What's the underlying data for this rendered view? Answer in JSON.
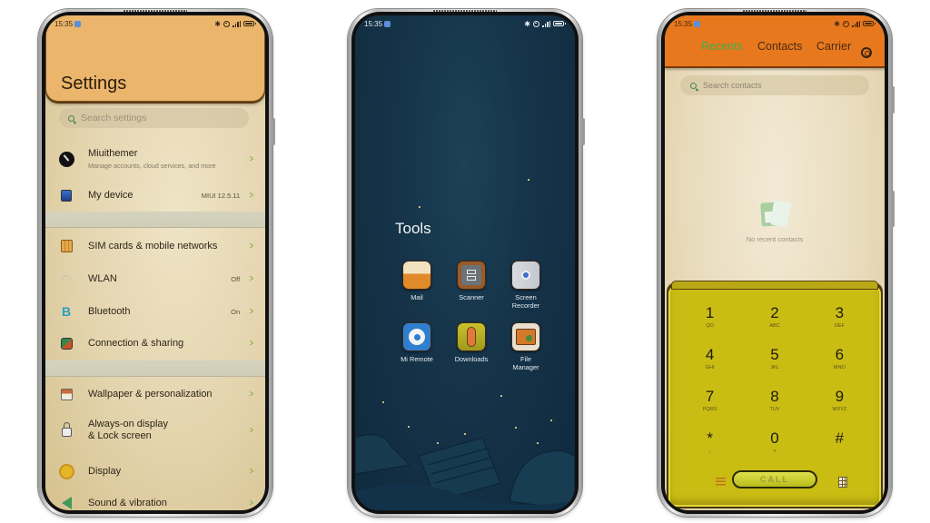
{
  "status_bar": {
    "time": "15:35",
    "icons": [
      "bluetooth-icon",
      "alarm-icon",
      "signal-icon",
      "battery-icon"
    ]
  },
  "settings": {
    "title": "Settings",
    "search_placeholder": "Search settings",
    "items": [
      {
        "icon": "miuithemer-icon",
        "label": "Miuithemer",
        "sub": "Manage accounts, cloud services, and more",
        "value": ""
      },
      {
        "icon": "device-icon",
        "label": "My device",
        "sub": "",
        "value": "MIUI 12.5.11"
      },
      {
        "icon": "sim-card-icon",
        "label": "SIM cards & mobile networks",
        "sub": "",
        "value": ""
      },
      {
        "icon": "wifi-icon",
        "label": "WLAN",
        "sub": "",
        "value": "Off"
      },
      {
        "icon": "bluetooth-icon",
        "label": "Bluetooth",
        "sub": "",
        "value": "On"
      },
      {
        "icon": "connection-icon",
        "label": "Connection & sharing",
        "sub": "",
        "value": ""
      },
      {
        "icon": "wallpaper-icon",
        "label": "Wallpaper & personalization",
        "sub": "",
        "value": ""
      },
      {
        "icon": "lock-icon",
        "label": "Always-on display & Lock screen",
        "sub": "",
        "value": ""
      },
      {
        "icon": "display-icon",
        "label": "Display",
        "sub": "",
        "value": ""
      },
      {
        "icon": "sound-icon",
        "label": "Sound & vibration",
        "sub": "",
        "value": ""
      }
    ]
  },
  "home": {
    "folder_title": "Tools",
    "apps": [
      {
        "name": "Mail",
        "icon": "mail-app-icon"
      },
      {
        "name": "Scanner",
        "icon": "scanner-app-icon"
      },
      {
        "name": "Screen Recorder",
        "icon": "screen-recorder-app-icon"
      },
      {
        "name": "Mi Remote",
        "icon": "mi-remote-app-icon"
      },
      {
        "name": "Downloads",
        "icon": "downloads-app-icon"
      },
      {
        "name": "File Manager",
        "icon": "file-manager-app-icon"
      }
    ]
  },
  "dialer": {
    "tabs": [
      "Recents",
      "Contacts",
      "Carrier"
    ],
    "active_tab": "Recents",
    "search_placeholder": "Search contacts",
    "empty_text": "No recent contacts",
    "keys": [
      {
        "digit": "1",
        "letters": "QO"
      },
      {
        "digit": "2",
        "letters": "ABC"
      },
      {
        "digit": "3",
        "letters": "DEF"
      },
      {
        "digit": "4",
        "letters": "GHI"
      },
      {
        "digit": "5",
        "letters": "JKL"
      },
      {
        "digit": "6",
        "letters": "MNO"
      },
      {
        "digit": "7",
        "letters": "PQRS"
      },
      {
        "digit": "8",
        "letters": "TUV"
      },
      {
        "digit": "9",
        "letters": "WXYZ"
      },
      {
        "digit": "*",
        "letters": ","
      },
      {
        "digit": "0",
        "letters": "+"
      },
      {
        "digit": "#",
        "letters": ""
      }
    ],
    "call_label": "CALL",
    "colors": {
      "header": "#e8781e",
      "keypad": "#c9bd14",
      "active_tab": "#3fae4a"
    }
  },
  "colors": {
    "settings_header": "#ebb56c",
    "home_bg": "#153349",
    "chevron": "#8ab04a"
  }
}
